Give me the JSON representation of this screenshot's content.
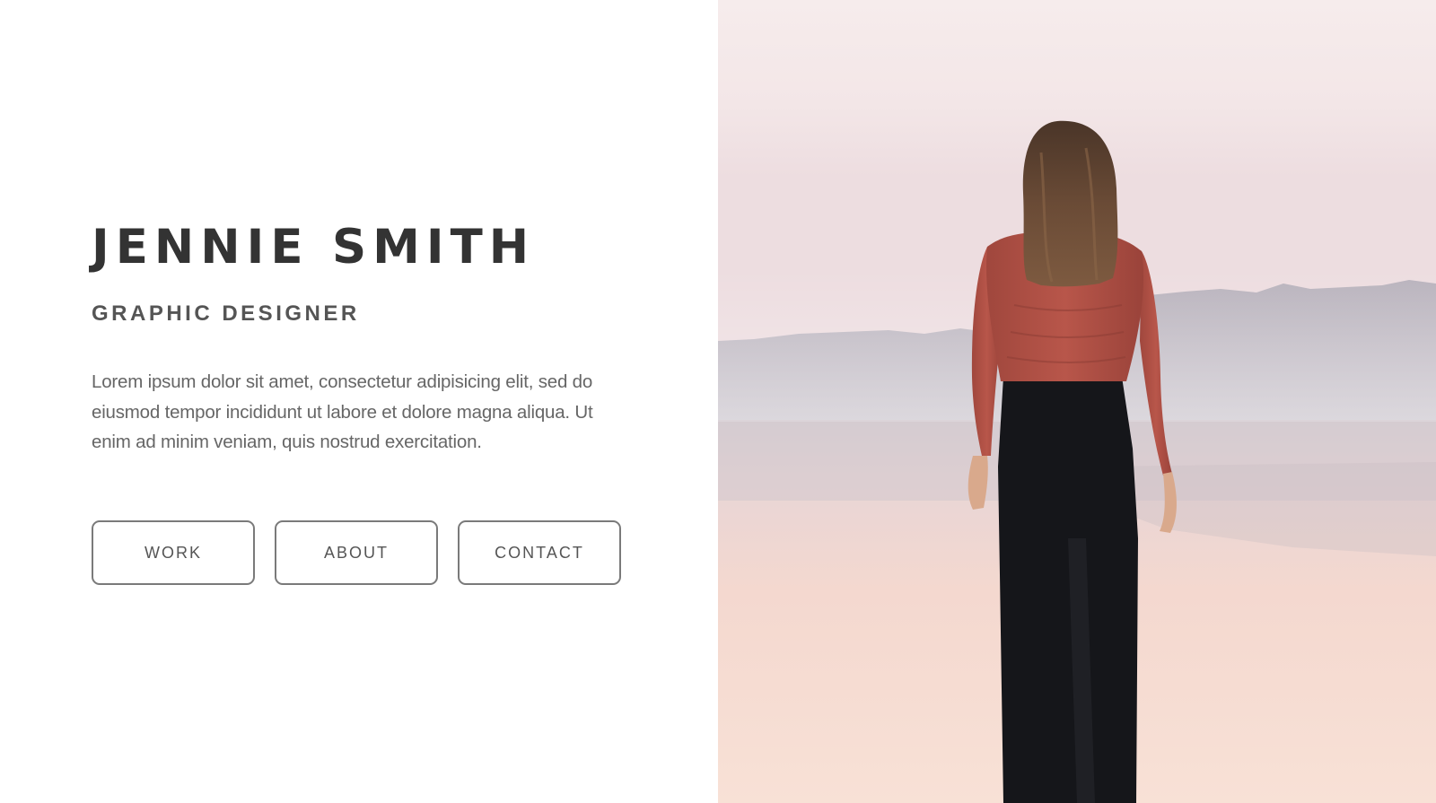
{
  "profile": {
    "name": "JENNIE SMITH",
    "role": "GRAPHIC DESIGNER",
    "bio": "Lorem ipsum dolor sit amet, consectetur adipisicing elit, sed do eiusmod tempor incididunt ut labore et dolore magna aliqua. Ut enim ad minim veniam, quis nostrud exercitation."
  },
  "nav": {
    "work_label": "WORK",
    "about_label": "ABOUT",
    "contact_label": "CONTACT"
  },
  "colors": {
    "heading": "#333333",
    "subheading": "#555555",
    "body_text": "#666666",
    "button_border": "#7a7a7a",
    "background": "#ffffff"
  },
  "hero_image": {
    "icon": "woman-at-lake-photo"
  }
}
